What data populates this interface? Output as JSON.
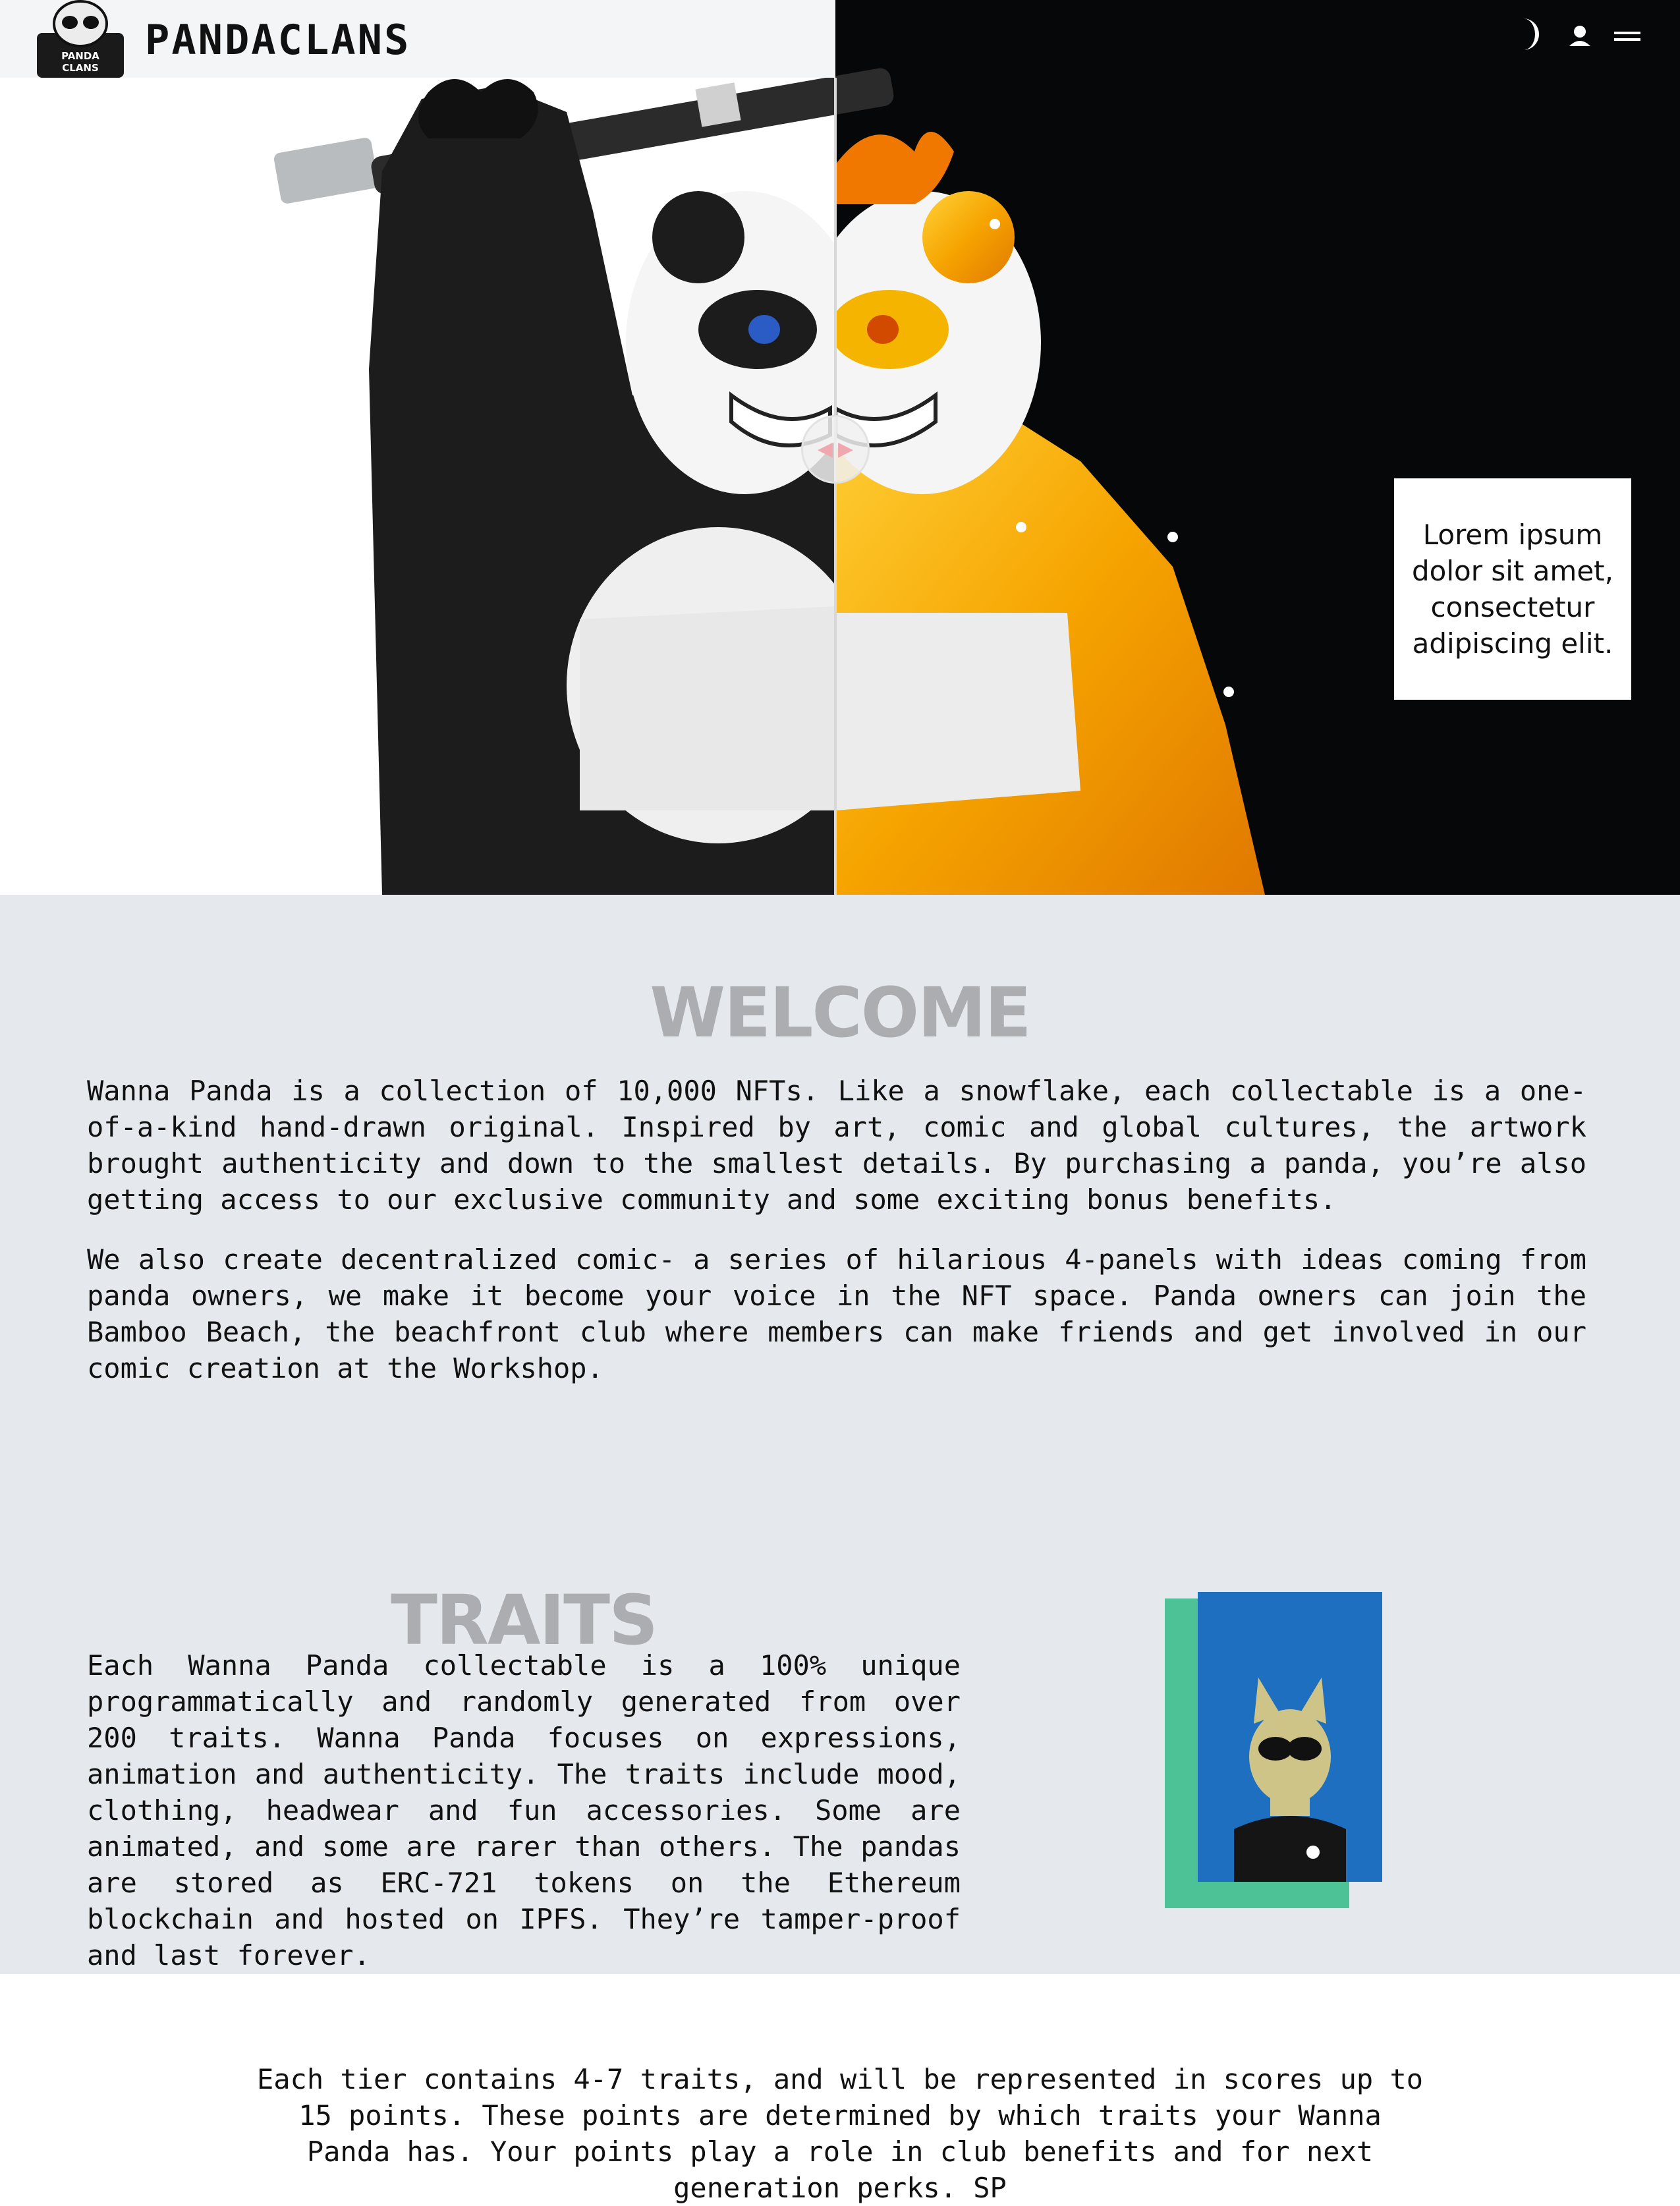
{
  "nav": {
    "brand": "PANDACLANS",
    "logo_caption_line1": "PANDA",
    "logo_caption_line2": "CLANS",
    "icons": [
      "moon-icon",
      "user-icon",
      "menu-icon"
    ]
  },
  "hero": {
    "callout_text": "Lorem ipsum dolor sit amet, consectetur adipiscing elit.",
    "slider_left_glyph": "◀",
    "slider_right_glyph": "▶",
    "colors": {
      "left_bg": "#ffffff",
      "right_bg": "#060708",
      "gold": "#f2a100"
    }
  },
  "welcome": {
    "title": "WELCOME",
    "paragraphs": [
      "Wanna Panda is a collection of 10,000 NFTs. Like a snowflake, each collectable is a one-of-a-kind hand-drawn original. Inspired by art, comic and global cultures, the artwork brought authenticity and down to the smallest details. By purchasing a panda, you’re also getting access to our exclusive community and some exciting bonus benefits.",
      "We also create decentralized comic- a series of hilarious 4-panels with ideas coming from panda owners, we make it become your voice in the NFT space. Panda owners can join the Bamboo Beach, the beachfront club where members can make friends and get involved in our comic creation at the Workshop."
    ]
  },
  "traits": {
    "title": "TRAITS",
    "text": "Each Wanna Panda collectable is a 100% unique programmatically and randomly generated from over 200 traits. Wanna Panda focuses on expressions, animation and authenticity. The traits include mood, clothing, headwear and fun accessories. Some are animated, and some are rarer than others. The pandas are stored as ERC-721 tokens on the Ethereum blockchain and hosted on IPFS. They’re tamper-proof and last forever."
  },
  "tiers": {
    "text": "Each tier contains 4-7 traits, and will be represented in scores up to 15 points. These points are determined by which traits your Wanna Panda has. Your points play a role in club benefits and for next generation perks. SP"
  },
  "colors": {
    "section_bg": "#e5e8ec",
    "nav_bg": "#f4f5f7",
    "title_gray": "#9a9a9d",
    "card_blue": "#1e6fc0",
    "card_green": "#4dc296"
  }
}
